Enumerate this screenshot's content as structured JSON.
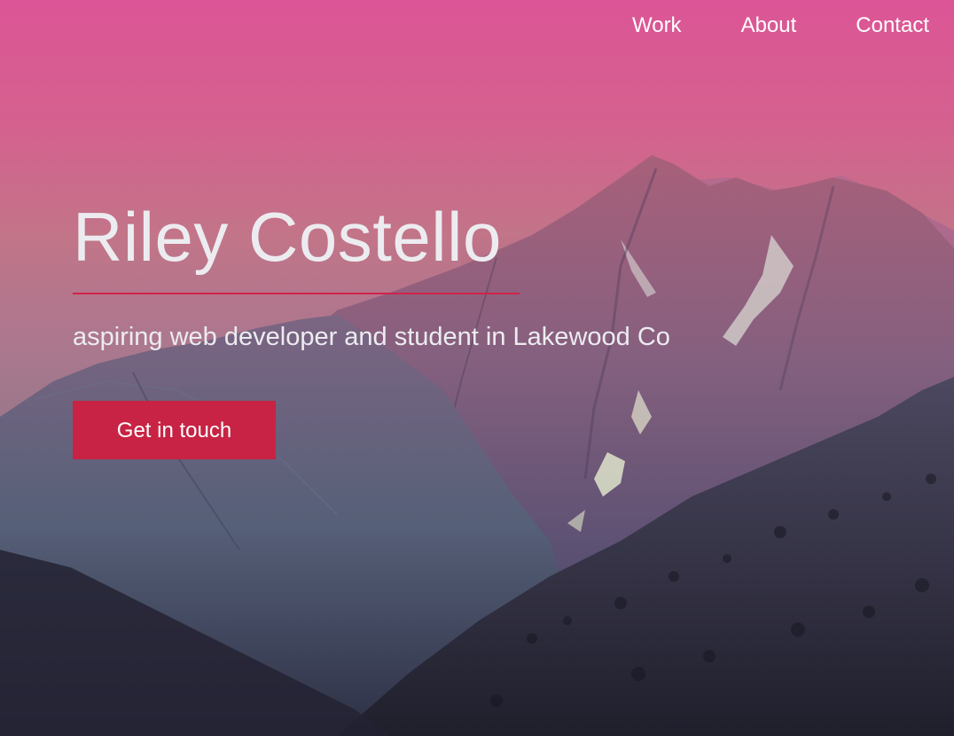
{
  "nav": {
    "items": [
      {
        "label": "Work"
      },
      {
        "label": "About"
      },
      {
        "label": "Contact"
      }
    ]
  },
  "hero": {
    "name": "Riley Costello",
    "tagline": "aspiring web developer and student in Lakewood Co",
    "cta_label": "Get in touch",
    "background": "mountain-peaks-sunset-image"
  },
  "colors": {
    "sky_top": "#dc5596",
    "accent": "#c82344",
    "divider": "#d0234a",
    "text": "#ececf0"
  }
}
